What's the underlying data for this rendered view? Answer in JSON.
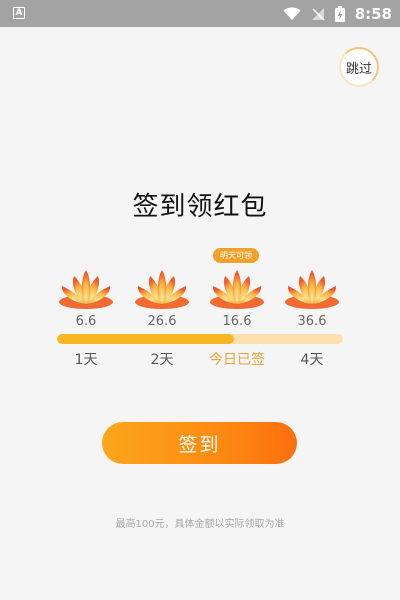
{
  "status_bar": {
    "time": "8:58",
    "app_icon_letter": "A"
  },
  "skip_button": {
    "label": "跳过"
  },
  "title": "签到领红包",
  "days": [
    {
      "amount": "6.6",
      "label": "1天"
    },
    {
      "amount": "26.6",
      "label": "2天"
    },
    {
      "amount": "16.6",
      "label": "今日已签"
    },
    {
      "amount": "36.6",
      "label": "4天"
    }
  ],
  "tomorrow_badge": "明天可领",
  "progress": {
    "fraction": 0.62
  },
  "sign_button": {
    "label": "签到"
  },
  "note": "最高100元，具体金额以实际领取为准",
  "colors": {
    "accent": "#fd8d13",
    "progress_fill": "#f8b722",
    "progress_track": "#fde0b0",
    "today_label": "#e9a43a"
  }
}
